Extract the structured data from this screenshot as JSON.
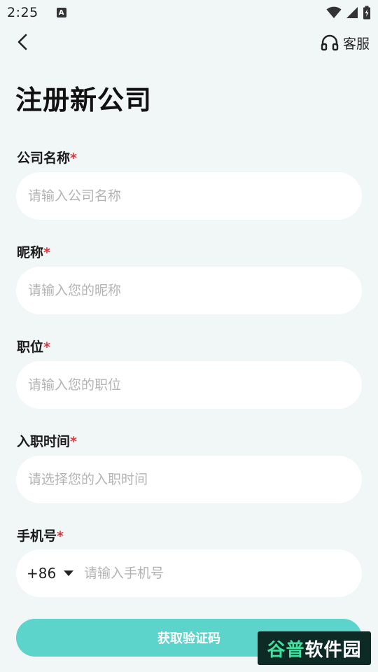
{
  "status_bar": {
    "time": "2:25",
    "a_glyph": "A",
    "icons": [
      "wifi-icon",
      "signal-icon",
      "battery-charging-icon"
    ]
  },
  "nav": {
    "back_icon": "chevron-left-icon",
    "support_icon": "headset-icon",
    "support_label": "客服"
  },
  "page_title": "注册新公司",
  "required_mark": "*",
  "fields": [
    {
      "label": "公司名称",
      "placeholder": "请输入公司名称",
      "value": ""
    },
    {
      "label": "昵称",
      "placeholder": "请输入您的昵称",
      "value": ""
    },
    {
      "label": "职位",
      "placeholder": "请输入您的职位",
      "value": ""
    },
    {
      "label": "入职时间",
      "placeholder": "请选择您的入职时间",
      "value": ""
    }
  ],
  "phone": {
    "label": "手机号",
    "country_code": "+86",
    "placeholder": "请输入手机号",
    "value": ""
  },
  "get_code_button": "获取验证码",
  "watermark": {
    "part1": "谷普",
    "part2": "软件园"
  },
  "colors": {
    "background": "#f1f6f6",
    "accent": "#5cd3cb",
    "required": "#e0353b",
    "placeholder": "#b3b3b3"
  }
}
